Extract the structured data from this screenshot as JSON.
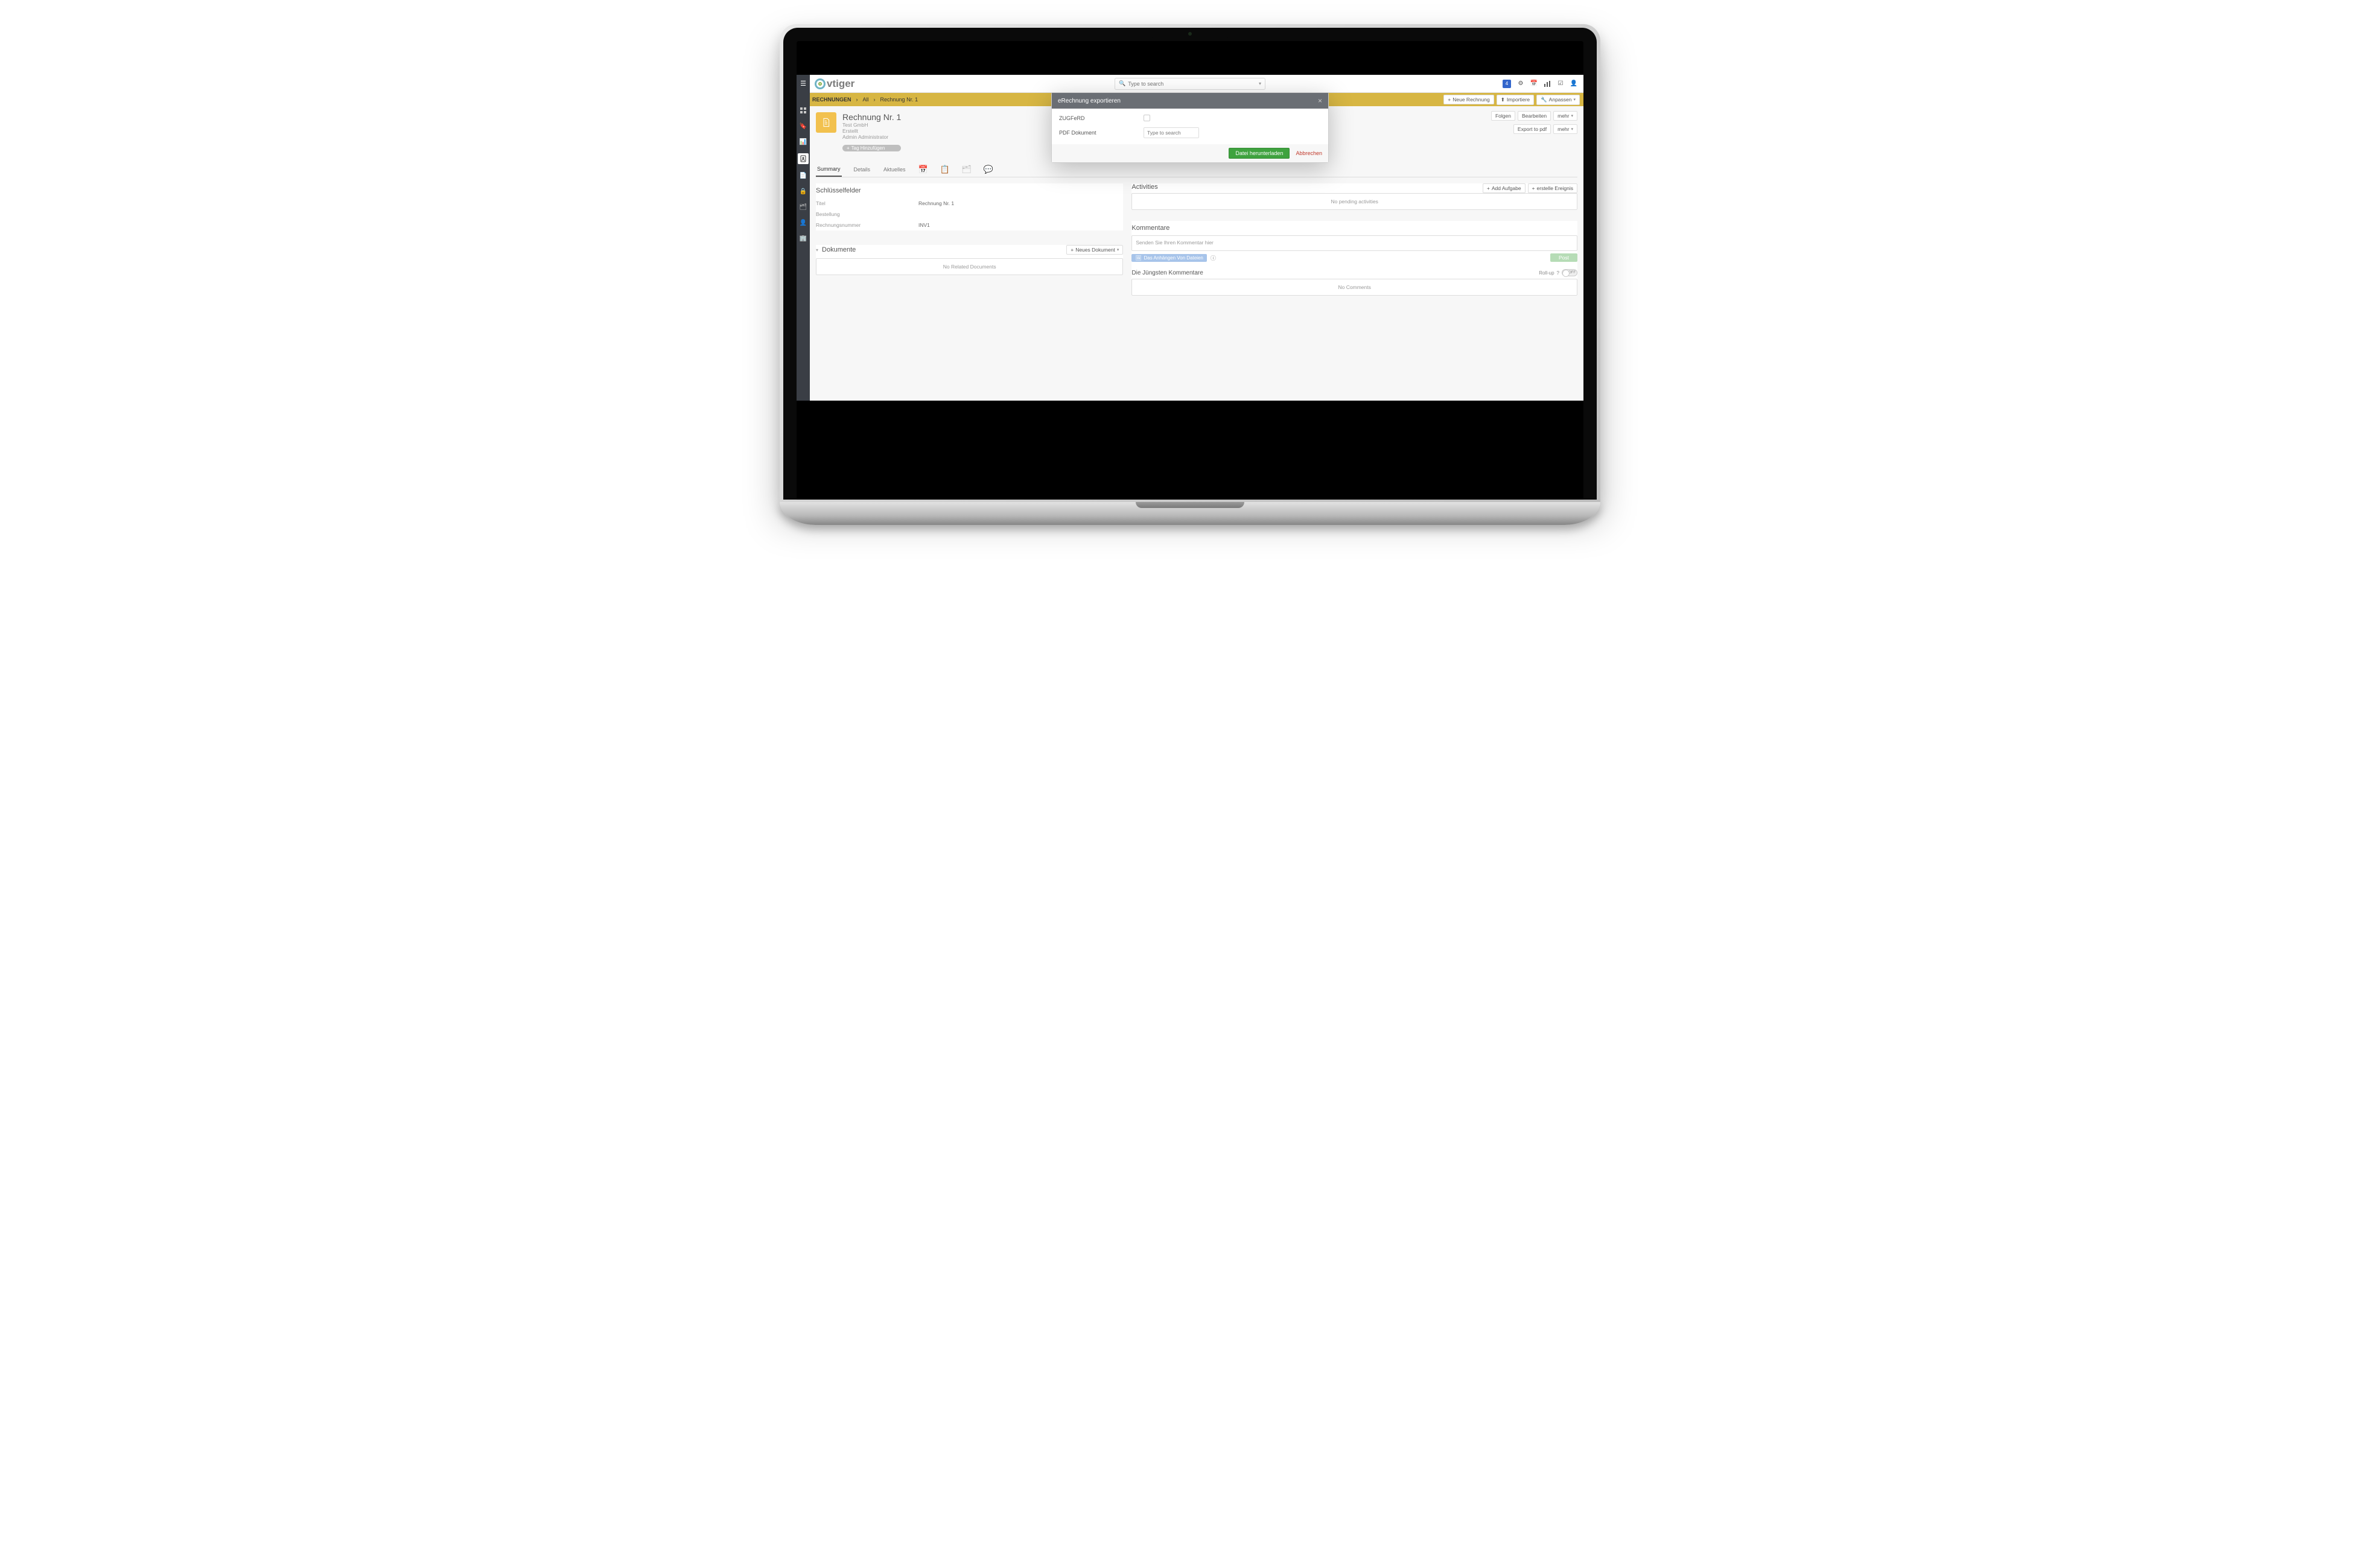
{
  "brand": "vtiger",
  "global_search": {
    "placeholder": "Type to search"
  },
  "top_icons": {
    "notifications_count": "4"
  },
  "module": {
    "name": "RECHNUNGEN",
    "crumb_all": "All",
    "crumb_current": "Rechnung Nr. 1"
  },
  "header_actions": {
    "new": "Neue Rechnung",
    "import": "Importiere",
    "customize": "Anpassen"
  },
  "record": {
    "title": "Rechnung Nr. 1",
    "org": "Test GmbH",
    "status": "Erstellt",
    "owner": "Admin Administrator",
    "tag_button": "Tag Hinzufügen"
  },
  "record_actions": {
    "follow": "Folgen",
    "edit": "Bearbeiten",
    "more": "mehr",
    "export_pdf": "Export to pdf",
    "more2": "mehr"
  },
  "tabs": {
    "summary": "Summary",
    "details": "Details",
    "updates": "Aktuelles"
  },
  "key_fields": {
    "heading": "Schlüsselfelder",
    "rows": {
      "title_label": "Titel",
      "title_value": "Rechnung Nr. 1",
      "order_label": "Bestellung",
      "order_value": "",
      "number_label": "Rechnungsnummer",
      "number_value": "INV1"
    }
  },
  "documents": {
    "heading": "Dokumente",
    "new_button": "Neues Dokument",
    "empty": "No Related Documents"
  },
  "activities": {
    "heading": "Activities",
    "add_task": "Add Aufgabe",
    "add_event": "erstelle Ereignis",
    "empty": "No pending activities"
  },
  "comments": {
    "heading": "Kommentare",
    "placeholder": "Senden Sie Ihren Kommentar hier",
    "attach": "Das Anhängen Von Dateien",
    "post": "Post",
    "recent_heading": "Die Jüngsten Kommentare",
    "rollup_label": "Roll-up",
    "toggle_state": "OFF",
    "empty": "No Comments"
  },
  "modal": {
    "title": "eRechnung exportieren",
    "field_zugferd": "ZUGFeRD",
    "field_pdf": "PDF Dokument",
    "search_placeholder": "Type to search",
    "download": "Datei herunterladen",
    "cancel": "Abbrechen"
  }
}
